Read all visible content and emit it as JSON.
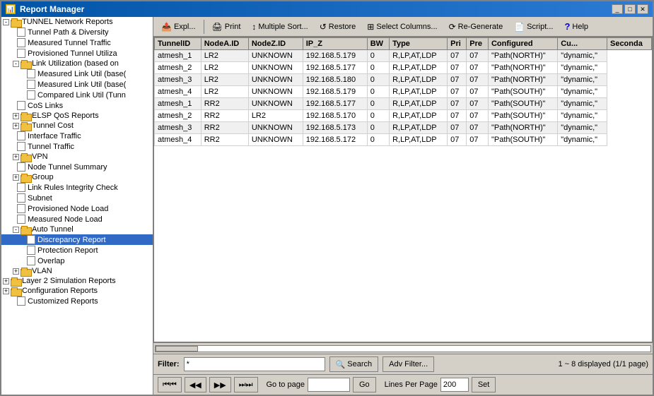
{
  "window": {
    "title": "Report Manager",
    "controls": [
      "minimize",
      "maximize",
      "close"
    ]
  },
  "sidebar": {
    "items": [
      {
        "id": "tunnel-network",
        "label": "TUNNEL Network Reports",
        "type": "folder",
        "expanded": true,
        "level": 0
      },
      {
        "id": "tunnel-path",
        "label": "Tunnel Path & Diversity",
        "type": "doc",
        "level": 1
      },
      {
        "id": "measured-tunnel",
        "label": "Measured Tunnel Traffic",
        "type": "doc",
        "level": 1
      },
      {
        "id": "provisioned-tunnel",
        "label": "Provisioned Tunnel Utiliza",
        "type": "doc",
        "level": 1
      },
      {
        "id": "link-util",
        "label": "Link Utilization (based on",
        "type": "folder",
        "expanded": true,
        "level": 1
      },
      {
        "id": "measured-util-based",
        "label": "Measured Link Util (base(",
        "type": "doc",
        "level": 2
      },
      {
        "id": "measured-util-based2",
        "label": "Measured Link Util (base(",
        "type": "doc",
        "level": 2
      },
      {
        "id": "compared-link",
        "label": "Compared Link Util (Tunn",
        "type": "doc",
        "level": 2
      },
      {
        "id": "cos-links",
        "label": "CoS Links",
        "type": "doc",
        "level": 1
      },
      {
        "id": "elsp-qos",
        "label": "ELSP QoS Reports",
        "type": "folder",
        "expanded": false,
        "level": 1
      },
      {
        "id": "tunnel-cost",
        "label": "Tunnel Cost",
        "type": "folder",
        "expanded": false,
        "level": 1
      },
      {
        "id": "interface-traffic",
        "label": "Interface Traffic",
        "type": "doc",
        "level": 1
      },
      {
        "id": "tunnel-traffic",
        "label": "Tunnel Traffic",
        "type": "doc",
        "level": 1
      },
      {
        "id": "vpn",
        "label": "VPN",
        "type": "folder",
        "expanded": false,
        "level": 1
      },
      {
        "id": "node-tunnel-summary",
        "label": "Node Tunnel Summary",
        "type": "doc",
        "level": 1
      },
      {
        "id": "group",
        "label": "Group",
        "type": "folder",
        "expanded": false,
        "level": 1
      },
      {
        "id": "link-rules",
        "label": "Link Rules Integrity Check",
        "type": "doc",
        "level": 1
      },
      {
        "id": "subnet",
        "label": "Subnet",
        "type": "doc",
        "level": 1
      },
      {
        "id": "provisioned-node-load",
        "label": "Provisioned Node Load",
        "type": "doc",
        "level": 1
      },
      {
        "id": "measured-node-load",
        "label": "Measured Node Load",
        "type": "doc",
        "level": 1
      },
      {
        "id": "auto-tunnel",
        "label": "Auto Tunnel",
        "type": "folder",
        "expanded": true,
        "level": 1
      },
      {
        "id": "discrepancy-report",
        "label": "Discrepancy Report",
        "type": "doc",
        "level": 2,
        "selected": true
      },
      {
        "id": "protection-report",
        "label": "Protection Report",
        "type": "doc",
        "level": 2
      },
      {
        "id": "overlap",
        "label": "Overlap",
        "type": "doc",
        "level": 2
      },
      {
        "id": "vlan",
        "label": "VLAN",
        "type": "folder",
        "expanded": false,
        "level": 1
      },
      {
        "id": "layer2-sim",
        "label": "Layer 2 Simulation Reports",
        "type": "folder",
        "expanded": false,
        "level": 0
      },
      {
        "id": "config-reports",
        "label": "Configuration Reports",
        "type": "folder",
        "expanded": false,
        "level": 0
      },
      {
        "id": "customized-reports",
        "label": "Customized Reports",
        "type": "doc",
        "level": 0
      }
    ]
  },
  "toolbar": {
    "export_label": "Expl...",
    "print_label": "Print",
    "sort_label": "Multiple Sort...",
    "restore_label": "Restore",
    "columns_label": "Select Columns...",
    "regen_label": "Re-Generate",
    "script_label": "Script...",
    "help_label": "Help"
  },
  "table": {
    "columns": [
      "TunnelID",
      "NodeA.ID",
      "NodeZ.ID",
      "IP_Z",
      "BW",
      "Type",
      "Pri",
      "Pre",
      "Configured",
      "Cu...",
      "Seconda"
    ],
    "rows": [
      [
        "atmesh_1",
        "LR2",
        "UNKNOWN",
        "192.168.5.179",
        "0",
        "R,LP,AT,LDP",
        "07",
        "07",
        "\"Path(NORTH)\"",
        "\"dynamic,\""
      ],
      [
        "atmesh_2",
        "LR2",
        "UNKNOWN",
        "192.168.5.177",
        "0",
        "R,LP,AT,LDP",
        "07",
        "07",
        "\"Path(NORTH)\"",
        "\"dynamic,\""
      ],
      [
        "atmesh_3",
        "LR2",
        "UNKNOWN",
        "192.168.5.180",
        "0",
        "R,LP,AT,LDP",
        "07",
        "07",
        "\"Path(NORTH)\"",
        "\"dynamic,\""
      ],
      [
        "atmesh_4",
        "LR2",
        "UNKNOWN",
        "192.168.5.179",
        "0",
        "R,LP,AT,LDP",
        "07",
        "07",
        "\"Path(SOUTH)\"",
        "\"dynamic,\""
      ],
      [
        "atmesh_1",
        "RR2",
        "UNKNOWN",
        "192.168.5.177",
        "0",
        "R,LP,AT,LDP",
        "07",
        "07",
        "\"Path(SOUTH)\"",
        "\"dynamic,\""
      ],
      [
        "atmesh_2",
        "RR2",
        "LR2",
        "192.168.5.170",
        "0",
        "R,LP,AT,LDP",
        "07",
        "07",
        "\"Path(SOUTH)\"",
        "\"dynamic,\""
      ],
      [
        "atmesh_3",
        "RR2",
        "UNKNOWN",
        "192.168.5.173",
        "0",
        "R,LP,AT,LDP",
        "07",
        "07",
        "\"Path(NORTH)\"",
        "\"dynamic,\""
      ],
      [
        "atmesh_4",
        "RR2",
        "UNKNOWN",
        "192.168.5.172",
        "0",
        "R,LP,AT,LDP",
        "07",
        "07",
        "\"Path(SOUTH)\"",
        "\"dynamic,\""
      ]
    ]
  },
  "bottom": {
    "filter_label": "Filter:",
    "filter_value": "*",
    "search_label": "Search",
    "adv_filter_label": "Adv Filter...",
    "status_text": "1 ~ 8 displayed (1/1 page)",
    "goto_label": "Go to page",
    "go_label": "Go",
    "lpp_label": "Lines Per Page",
    "lpp_value": "200",
    "set_label": "Set"
  }
}
